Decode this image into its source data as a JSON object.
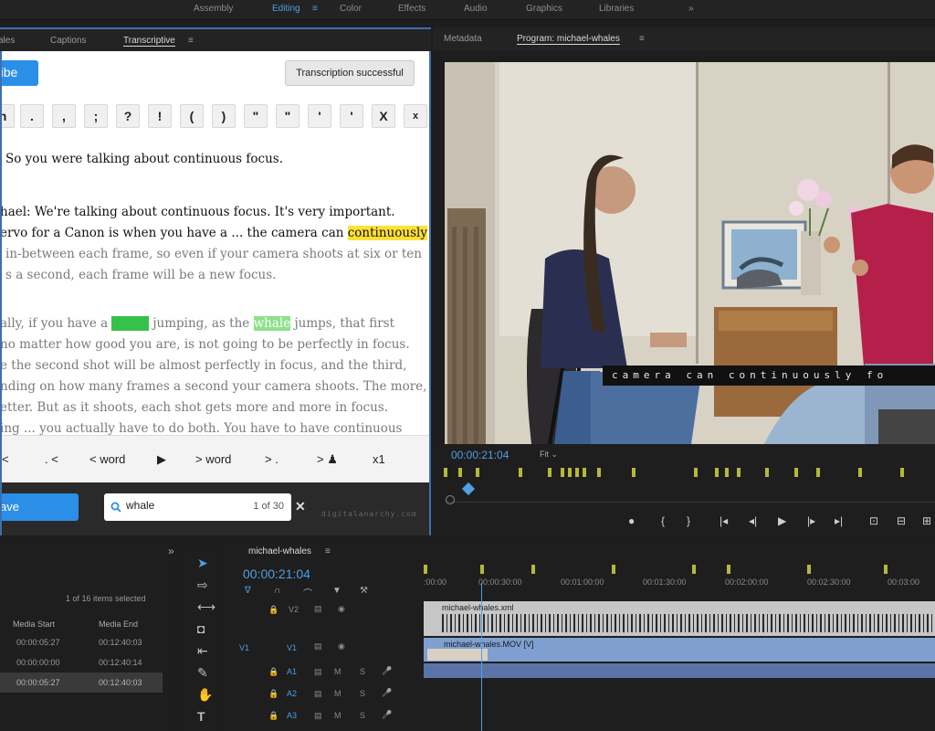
{
  "workspaces": {
    "items": [
      {
        "label": "Assembly",
        "active": false
      },
      {
        "label": "Editing",
        "active": true
      },
      {
        "label": "Color",
        "active": false
      },
      {
        "label": "Effects",
        "active": false
      },
      {
        "label": "Audio",
        "active": false
      },
      {
        "label": "Graphics",
        "active": false
      },
      {
        "label": "Libraries",
        "active": false
      }
    ],
    "more": "»",
    "menu": "≡"
  },
  "transcriptive": {
    "tabs": [
      "ales",
      "Captions",
      "Transcriptive"
    ],
    "tab_menu": "≡",
    "transcribe_button": "ribe",
    "status": "Transcription successful",
    "punctuation": [
      "n",
      ".",
      ",",
      ";",
      "?",
      "!",
      "(",
      ")",
      "\"",
      "\"",
      "'",
      "'",
      "X",
      "x"
    ],
    "transcript": {
      "l1": "So you were talking about continuous focus.",
      "l2": "hael: We're talking about continuous focus. It's very important.",
      "l3a": "ervo for a Canon is when you have a ... the camera can ",
      "l3b": "continuously",
      "l4": "in-between each frame, so even if your camera shoots at six or ten",
      "l5": "s a second, each frame will be a new focus.",
      "l6a": "ally, if you have a ",
      "l6b": "whale",
      "l6c": " jumping, as the ",
      "l6d": "whale",
      "l6e": " jumps, that first",
      "l7": "no matter how good you are, is not going to be perfectly in focus.",
      "l8": "e the second shot will be almost perfectly in focus, and the third,",
      "l9": "nding on how many frames a second your camera shoots. The more,",
      "l10": "etter. But as it shoots, each shot gets more and more in focus.",
      "l11": "ing ... you actually have to do both. You have to have continuous"
    },
    "nav": [
      "<",
      ". <",
      "< word",
      "▶",
      "> word",
      "> .",
      ">",
      "x1"
    ],
    "save_button": "ave",
    "search": {
      "value": "whale",
      "count": "1 of 30",
      "close": "✕"
    },
    "brand": "digitalanarchy.com"
  },
  "program": {
    "tabs": [
      "Metadata",
      "Program: michael-whales"
    ],
    "tab_menu": "≡",
    "subtitle": "camera can continuously fo",
    "timecode": "00:00:21:04",
    "fit": "Fit",
    "transport": [
      "●",
      "{",
      "}",
      "|◂",
      "◂|",
      "▶",
      "|▸",
      "▸|",
      "⊡",
      "⊟",
      "⊞"
    ]
  },
  "project": {
    "more": "»",
    "selected_info": "1 of 16 items selected",
    "columns": [
      "Media Start",
      "Media End"
    ],
    "rows": [
      {
        "start": "00:00:05:27",
        "end": "00:12:40:03"
      },
      {
        "start": "00:00:00:00",
        "end": "00:12:40:14"
      },
      {
        "start": "00:00:05:27",
        "end": "00:12:40:03"
      }
    ]
  },
  "timeline": {
    "sequence": "michael-whales",
    "menu": "≡",
    "timecode": "00:00:21:04",
    "ruler": [
      ":00:00",
      "00:00:30:00",
      "00:01:00:00",
      "00:01:30:00",
      "00:02:00:00",
      "00:02:30:00",
      "00:03:00"
    ],
    "tracks": [
      {
        "name": "V2"
      },
      {
        "name": "V1",
        "src": "V1"
      },
      {
        "name": "A1"
      },
      {
        "name": "A2"
      },
      {
        "name": "A3"
      }
    ],
    "clip_xml": "michael-whales.xml",
    "clip_mov": "michael-whales.MOV [V]"
  },
  "colors": {
    "accent": "#2b8fe8",
    "panel_border": "#3b6fb0",
    "highlight_yellow": "#ffe135",
    "highlight_green": "#35c24a",
    "timecode_blue": "#4f9fe3"
  }
}
